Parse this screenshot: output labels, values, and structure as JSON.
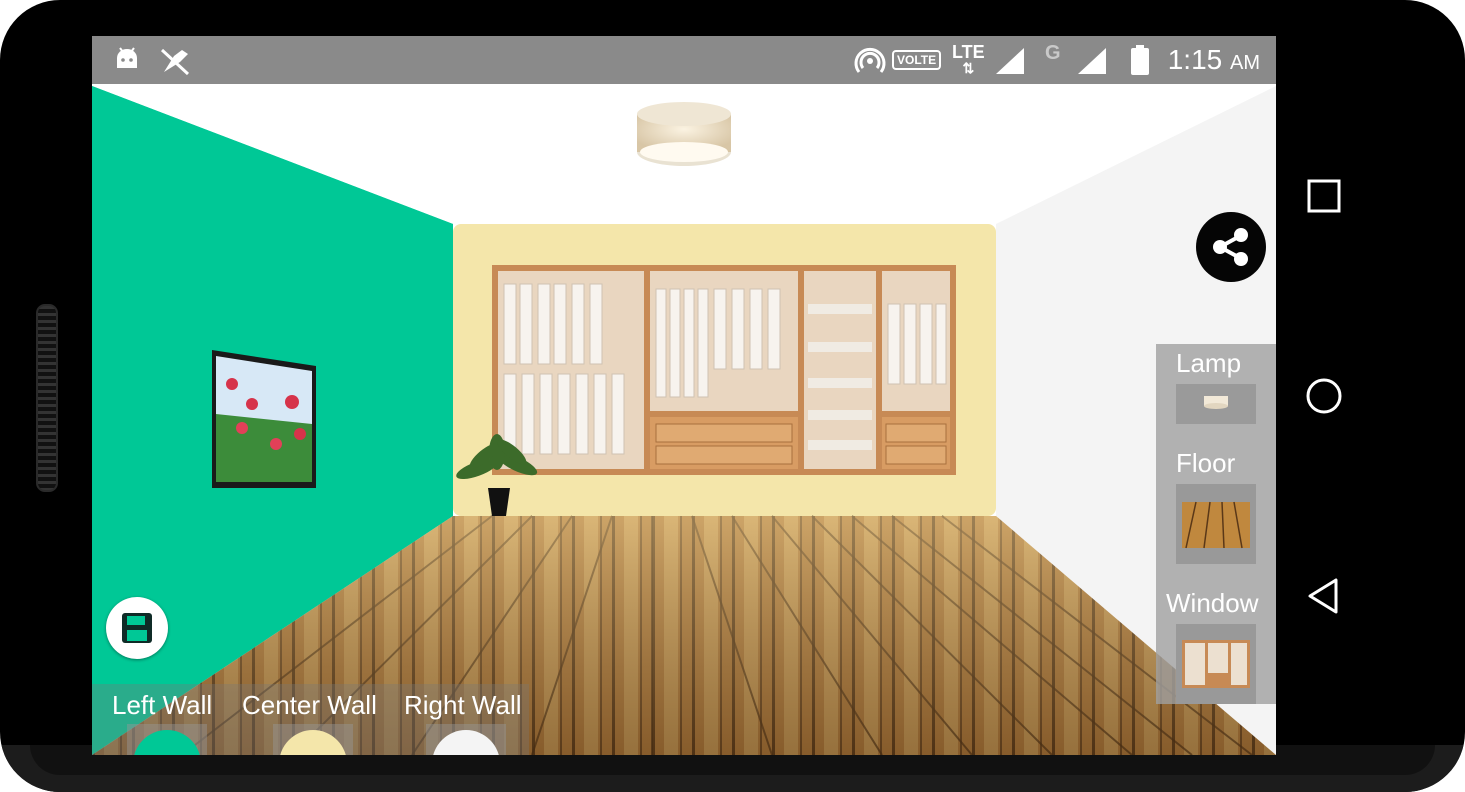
{
  "status_bar": {
    "time": "1:15",
    "am_pm": "AM",
    "volte_label": "VOLTE",
    "lte_label": "LTE",
    "network_g_label": "G",
    "icons": [
      "android-debug-icon",
      "no-location-icon",
      "hotspot-icon",
      "signal-icon",
      "battery-icon"
    ]
  },
  "room": {
    "left_wall_color": "#00C896",
    "center_wall_color": "#F4E6AA",
    "right_wall_color": "#F4F4F4"
  },
  "bottom_panel": {
    "left_wall_label": "Left Wall",
    "center_wall_label": "Center Wall",
    "right_wall_label": "Right Wall"
  },
  "right_panel": {
    "lamp_label": "Lamp",
    "floor_label": "Floor",
    "window_label": "Window"
  },
  "buttons": {
    "share_icon": "share-icon",
    "save_icon": "save-icon"
  },
  "nav": {
    "icons": [
      "recents-icon",
      "home-icon",
      "back-icon"
    ]
  }
}
